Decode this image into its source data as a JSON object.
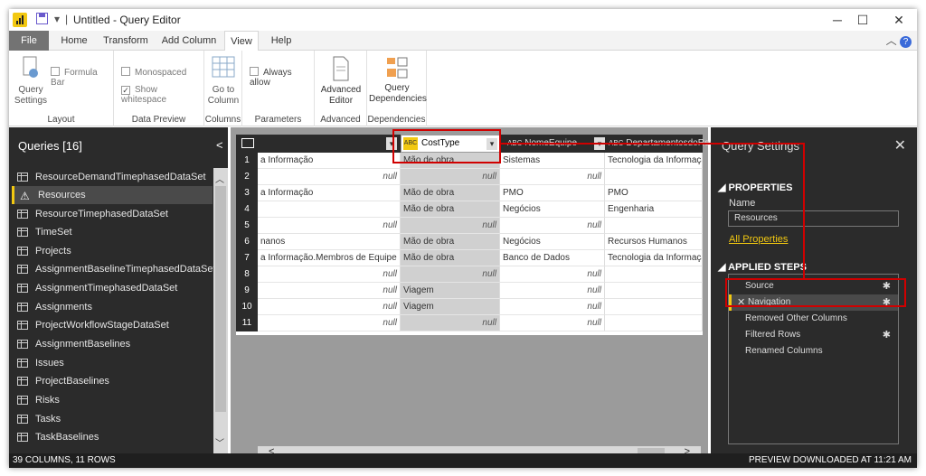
{
  "window": {
    "title": "Untitled - Query Editor",
    "separator": "|",
    "qa_dropdown": "▾",
    "minimize": "─",
    "maximize": "☐",
    "close": "✕"
  },
  "tabs": [
    "File",
    "Home",
    "Transform",
    "Add Column",
    "View",
    "Help"
  ],
  "ribbon": {
    "query_settings": "Query Settings",
    "formula_bar": "Formula Bar",
    "layout": "Layout",
    "monospaced": "Monospaced",
    "show_whitespace": "Show whitespace",
    "data_preview": "Data Preview",
    "goto_column": "Go to Column",
    "columns": "Columns",
    "always_allow": "Always allow",
    "parameters": "Parameters",
    "advanced_editor": "Advanced Editor",
    "advanced": "Advanced",
    "query_dependencies": "Query Dependencies",
    "dependencies": "Dependencies"
  },
  "queries": {
    "title": "Queries [16]",
    "collapse": "<",
    "items": [
      "ResourceDemandTimephasedDataSet",
      "Resources",
      "ResourceTimephasedDataSet",
      "TimeSet",
      "Projects",
      "AssignmentBaselineTimephasedDataSet",
      "AssignmentTimephasedDataSet",
      "Assignments",
      "ProjectWorkflowStageDataSet",
      "AssignmentBaselines",
      "Issues",
      "ProjectBaselines",
      "Risks",
      "Tasks",
      "TaskBaselines"
    ]
  },
  "grid": {
    "headers": [
      "",
      "CostType",
      "NomeEquipe",
      "DepartamentosdoRec"
    ],
    "type_icon": "ABC",
    "rows": [
      [
        "a Informação",
        "Mão de obra",
        "Sistemas",
        "Tecnologia da Informação"
      ],
      [
        "null",
        "null",
        "null",
        ""
      ],
      [
        "a Informação",
        "Mão de obra",
        "PMO",
        "PMO"
      ],
      [
        "",
        "Mão de obra",
        "Negócios",
        "Engenharia"
      ],
      [
        "null",
        "null",
        "null",
        ""
      ],
      [
        "nanos",
        "Mão de obra",
        "Negócios",
        "Recursos Humanos"
      ],
      [
        "a Informação.Membros de Equipe",
        "Mão de obra",
        "Banco de Dados",
        "Tecnologia da Informação"
      ],
      [
        "null",
        "null",
        "null",
        ""
      ],
      [
        "null",
        "Viagem",
        "null",
        ""
      ],
      [
        "null",
        "Viagem",
        "null",
        ""
      ],
      [
        "null",
        "null",
        "null",
        ""
      ]
    ]
  },
  "settings": {
    "title": "Query Settings",
    "close": "✕",
    "properties": "PROPERTIES",
    "name_label": "Name",
    "name_value": "Resources",
    "all_properties": "All Properties",
    "applied_steps": "APPLIED STEPS",
    "steps": [
      "Source",
      "Navigation",
      "Removed Other Columns",
      "Filtered Rows",
      "Renamed Columns"
    ]
  },
  "status": {
    "left": "39 COLUMNS, 11 ROWS",
    "right": "PREVIEW DOWNLOADED AT 11:21 AM"
  }
}
